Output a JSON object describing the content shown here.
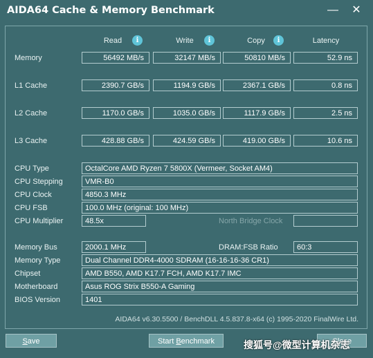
{
  "window": {
    "title": "AIDA64 Cache & Memory Benchmark",
    "minimize_glyph": "—",
    "close_glyph": "✕"
  },
  "columns": {
    "read": "Read",
    "write": "Write",
    "copy": "Copy",
    "latency": "Latency",
    "info_glyph": "i"
  },
  "rows": {
    "memory": {
      "label": "Memory",
      "read": "56492 MB/s",
      "write": "32147 MB/s",
      "copy": "50810 MB/s",
      "latency": "52.9 ns"
    },
    "l1": {
      "label": "L1 Cache",
      "read": "2390.7 GB/s",
      "write": "1194.9 GB/s",
      "copy": "2367.1 GB/s",
      "latency": "0.8 ns"
    },
    "l2": {
      "label": "L2 Cache",
      "read": "1170.0 GB/s",
      "write": "1035.0 GB/s",
      "copy": "1117.9 GB/s",
      "latency": "2.5 ns"
    },
    "l3": {
      "label": "L3 Cache",
      "read": "428.88 GB/s",
      "write": "424.59 GB/s",
      "copy": "419.00 GB/s",
      "latency": "10.6 ns"
    }
  },
  "info": {
    "cpu_type": {
      "label": "CPU Type",
      "value": "OctalCore AMD Ryzen 7 5800X  (Vermeer, Socket AM4)"
    },
    "cpu_stepping": {
      "label": "CPU Stepping",
      "value": "VMR-B0"
    },
    "cpu_clock": {
      "label": "CPU Clock",
      "value": "4850.3 MHz"
    },
    "cpu_fsb": {
      "label": "CPU FSB",
      "value": "100.0 MHz  (original: 100 MHz)"
    },
    "cpu_multiplier": {
      "label": "CPU Multiplier",
      "value": "48.5x"
    },
    "north_bridge_clock": {
      "label": "North Bridge Clock",
      "value": ""
    },
    "memory_bus": {
      "label": "Memory Bus",
      "value": "2000.1 MHz"
    },
    "dram_fsb_ratio": {
      "label": "DRAM:FSB Ratio",
      "value": "60:3"
    },
    "memory_type": {
      "label": "Memory Type",
      "value": "Dual Channel DDR4-4000 SDRAM  (16-16-16-36 CR1)"
    },
    "chipset": {
      "label": "Chipset",
      "value": "AMD B550, AMD K17.7 FCH, AMD K17.7 IMC"
    },
    "motherboard": {
      "label": "Motherboard",
      "value": "Asus ROG Strix B550-A Gaming"
    },
    "bios_version": {
      "label": "BIOS Version",
      "value": "1401"
    }
  },
  "footer": "AIDA64 v6.30.5500 / BenchDLL 4.5.837.8-x64  (c) 1995-2020 FinalWire Ltd.",
  "buttons": {
    "save_first": "S",
    "save_rest": "ave",
    "start_first": "Start ",
    "start_under": "B",
    "start_rest": "enchmark",
    "close": "Close"
  },
  "watermark": "搜狐号@微型计算机杂志"
}
